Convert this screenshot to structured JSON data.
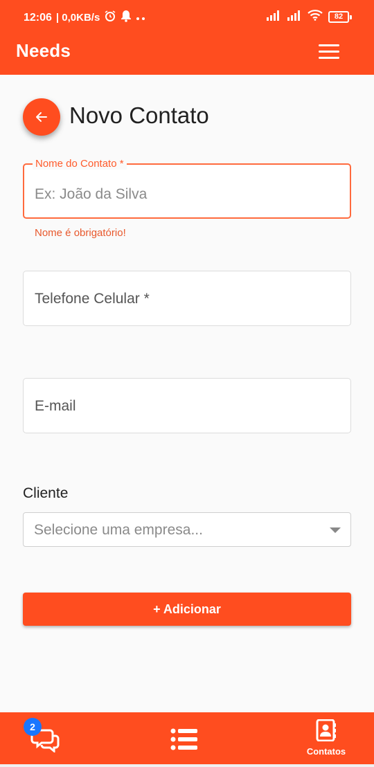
{
  "status_bar": {
    "time": "12:06",
    "speed": "| 0,0KB/s",
    "battery": "82"
  },
  "app_bar": {
    "title": "Needs"
  },
  "page": {
    "title": "Novo Contato"
  },
  "form": {
    "nome": {
      "label": "Nome do Contato *",
      "placeholder": "Ex: João da Silva",
      "error": "Nome é obrigatório!"
    },
    "telefone": {
      "placeholder": "Telefone Celular *"
    },
    "email": {
      "placeholder": "E-mail"
    },
    "cliente": {
      "label": "Cliente",
      "placeholder": "Selecione uma empresa..."
    },
    "submit_label": "+ Adicionar"
  },
  "bottom_nav": {
    "chat_badge": "2",
    "contacts_label": "Contatos"
  },
  "colors": {
    "primary": "#ff4d1f",
    "error": "#e8582c",
    "badge": "#1976ff"
  }
}
